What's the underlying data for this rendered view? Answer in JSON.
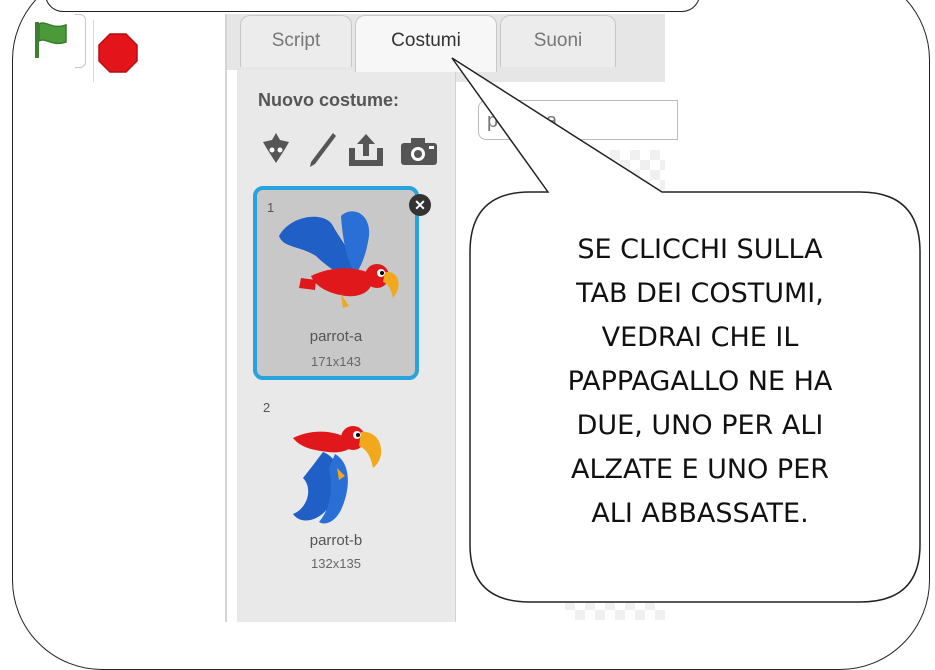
{
  "tabs": [
    {
      "label": "Script"
    },
    {
      "label": "Costumi"
    },
    {
      "label": "Suoni"
    }
  ],
  "costumes_panel": {
    "new_costume_label": "Nuovo costume:",
    "tools": [
      "paint-sprite-icon",
      "paintbrush-icon",
      "upload-icon",
      "camera-icon"
    ],
    "items": [
      {
        "number": "1",
        "name": "parrot-a",
        "size": "171x143",
        "selected": true
      },
      {
        "number": "2",
        "name": "parrot-b",
        "size": "132x135",
        "selected": false
      }
    ]
  },
  "editor": {
    "costume_name_value": "parrot-a"
  },
  "controls": {
    "flag": "green-flag-icon",
    "stop": "stop-icon"
  },
  "callout": {
    "lines": [
      "SE CLICCHI SULLA",
      "TAB DEI COSTUMI,",
      "VEDRAI CHE IL",
      "PAPPAGALLO NE HA",
      "DUE, UNO PER ALI",
      "ALZATE E UNO PER",
      "ALI ABBASSATE."
    ]
  },
  "colors": {
    "selection_blue": "#29a3dd",
    "flag_green": "#4a9a3a",
    "stop_red": "#e4141b"
  }
}
